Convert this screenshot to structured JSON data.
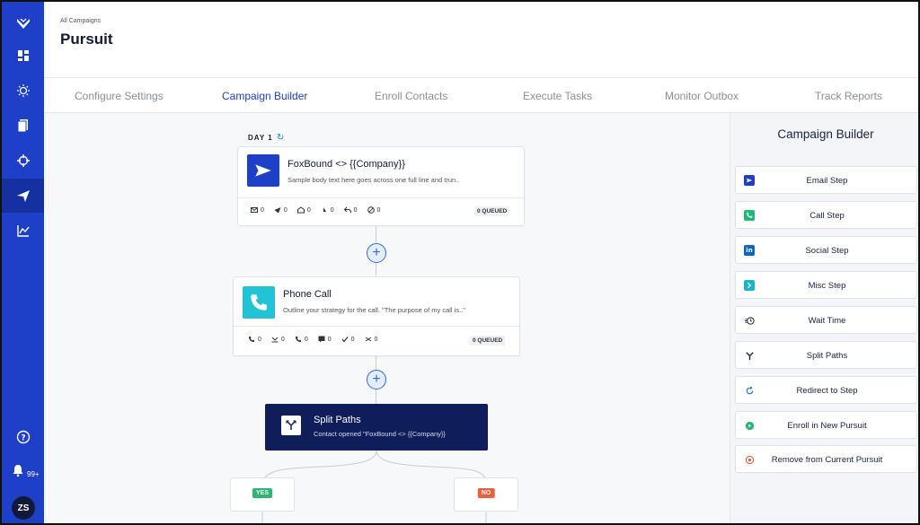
{
  "app": {
    "avatar_initials": "ZS",
    "notification_count": "99+"
  },
  "header": {
    "breadcrumb": "All Campaigns",
    "title": "Pursuit"
  },
  "tabs": [
    {
      "label": "Configure Settings"
    },
    {
      "label": "Campaign Builder",
      "active": true
    },
    {
      "label": "Enroll Contacts"
    },
    {
      "label": "Execute Tasks"
    },
    {
      "label": "Monitor Outbox"
    },
    {
      "label": "Track Reports"
    }
  ],
  "canvas": {
    "day_label": "DAY 1",
    "email_step": {
      "icon": "send-icon",
      "title": "FoxBound <> {{Company}}",
      "body": "Sample body text here goes across one full line and trun..",
      "stats": [
        "0",
        "0",
        "0",
        "0",
        "0",
        "0"
      ],
      "queued": "0 QUEUED"
    },
    "call_step": {
      "icon": "phone-icon",
      "title": "Phone Call",
      "body": "Outline your strategy for the call. \"The purpose of my call is..\"",
      "stats": [
        "0",
        "0",
        "0",
        "0",
        "0",
        "0"
      ],
      "queued": "0 QUEUED"
    },
    "split_step": {
      "icon": "split-icon",
      "title": "Split Paths",
      "body": "Contact opened \"FoxBound <> {{Company}}"
    },
    "branches": {
      "yes": "YES",
      "no": "NO"
    }
  },
  "panel": {
    "title": "Campaign Builder",
    "buttons": [
      {
        "label": "Email Step",
        "icon": "send-icon",
        "color": "#1e40c8"
      },
      {
        "label": "Call Step",
        "icon": "phone-icon",
        "color": "#1fb87a"
      },
      {
        "label": "Social Step",
        "icon": "linkedin-icon",
        "color": "#0a66c2"
      },
      {
        "label": "Misc Step",
        "icon": "chevron-right-icon",
        "color": "#19b5c9"
      },
      {
        "label": "Wait Time",
        "icon": "timer-icon",
        "color": "#1b2240"
      },
      {
        "label": "Split Paths",
        "icon": "split-icon",
        "color": "#1b2240"
      },
      {
        "label": "Redirect to Step",
        "icon": "redirect-icon",
        "color": "#1e7ad8"
      },
      {
        "label": "Enroll in New Pursuit",
        "icon": "play-circle-icon",
        "color": "#22b573"
      },
      {
        "label": "Remove from Current Pursuit",
        "icon": "stop-circle-icon",
        "color": "#e8603c"
      }
    ]
  },
  "colors": {
    "sidebar": "#1e40c8",
    "accent": "#1e40c8",
    "split_card": "#0f1d5a",
    "yes": "#2bb673",
    "no": "#e8603c"
  }
}
